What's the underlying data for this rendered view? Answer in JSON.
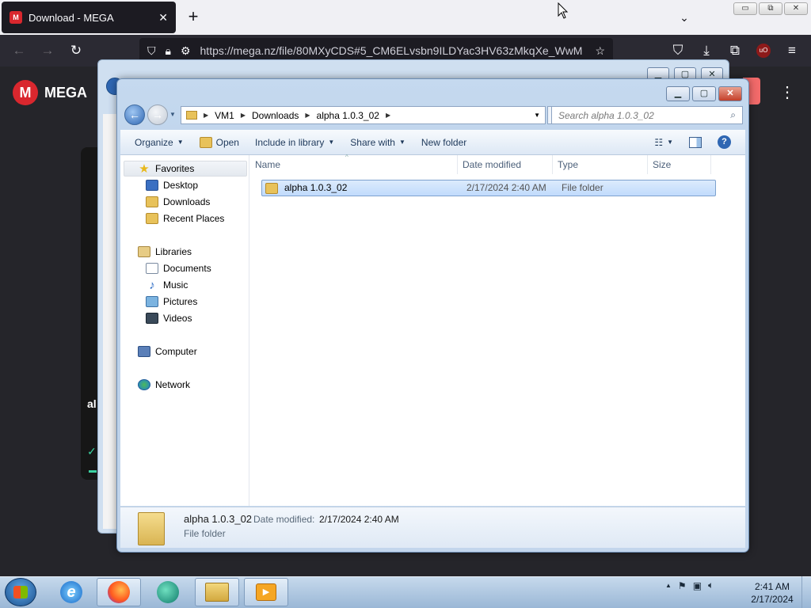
{
  "browser": {
    "tab_title": "Download - MEGA",
    "tab_favicon": "M",
    "tab_close": "✕",
    "new_tab": "+",
    "url": "https://mega.nz/file/80MXyCDS#5_CM6ELvsbn9ILDYac3HV63zMkqXe_WwM",
    "win_minimize": "▭",
    "win_restore": "⧉",
    "win_close": "✕"
  },
  "mega": {
    "logo_letter": "M",
    "logo_text": "MEGA",
    "partial_text": "al",
    "menu_dots": "⋮"
  },
  "explorer": {
    "breadcrumb": [
      "VM1",
      "Downloads",
      "alpha 1.0.3_02"
    ],
    "search_placeholder": "Search alpha 1.0.3_02",
    "toolbar": {
      "organize": "Organize",
      "open": "Open",
      "include_in_library": "Include in library",
      "share_with": "Share with",
      "new_folder": "New folder"
    },
    "nav": {
      "favorites": "Favorites",
      "desktop": "Desktop",
      "downloads": "Downloads",
      "recent_places": "Recent Places",
      "libraries": "Libraries",
      "documents": "Documents",
      "music": "Music",
      "pictures": "Pictures",
      "videos": "Videos",
      "computer": "Computer",
      "network": "Network"
    },
    "columns": {
      "name": "Name",
      "date_modified": "Date modified",
      "type": "Type",
      "size": "Size"
    },
    "files": [
      {
        "name": "alpha 1.0.3_02",
        "date_modified": "2/17/2024 2:40 AM",
        "type": "File folder",
        "size": ""
      }
    ],
    "details": {
      "name": "alpha 1.0.3_02",
      "date_label": "Date modified:",
      "date_value": "2/17/2024 2:40 AM",
      "type": "File folder"
    }
  },
  "taskbar": {
    "time": "2:41 AM",
    "date": "2/17/2024"
  },
  "colors": {
    "firefox_dark": "#1c1b22",
    "mega_red": "#d9272e",
    "selection": "#c1dbfc"
  }
}
